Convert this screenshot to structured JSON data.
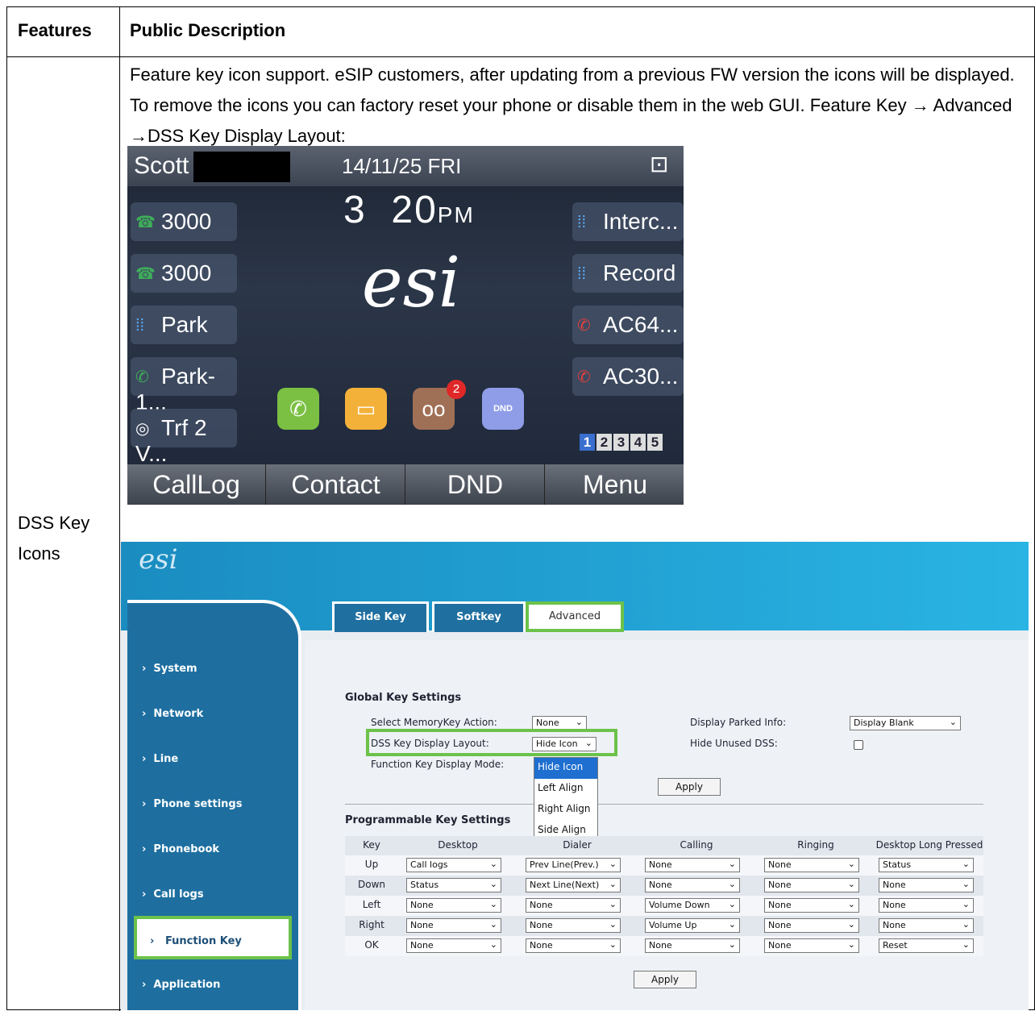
{
  "table": {
    "header_features": "Features",
    "header_description": "Public Description",
    "feature_name": "DSS Key Icons",
    "description": "Feature key icon support. eSIP customers, after updating from a previous FW version the icons will be displayed. To remove the icons you can factory reset your phone or disable them in the web GUI. Feature Key → Advanced →DSS Key Display Layout:"
  },
  "phone": {
    "name": "Scott",
    "date": "14/11/25 FRI",
    "time_hour": "3",
    "time_min": "20",
    "time_suffix": "PM",
    "logo": "esi",
    "left_keys": [
      "3000",
      "3000",
      "Park",
      "Park-1...",
      "Trf 2 V..."
    ],
    "right_keys": [
      "Interc...",
      "Record",
      "AC64...",
      "AC30..."
    ],
    "voicemail_badge": "2",
    "dnd_icon_label": "DND",
    "pages": [
      "1",
      "2",
      "3",
      "4",
      "5"
    ],
    "softkeys": [
      "CallLog",
      "Contact",
      "DND",
      "Menu"
    ]
  },
  "web": {
    "logo": "esi",
    "tabs": [
      "Side Key",
      "Softkey",
      "Advanced"
    ],
    "sidebar": [
      "System",
      "Network",
      "Line",
      "Phone settings",
      "Phonebook",
      "Call logs",
      "Function Key",
      "Application"
    ],
    "global_title": "Global Key Settings",
    "select_memorykey_label": "Select MemoryKey Action:",
    "select_memorykey_value": "None",
    "dss_layout_label": "DSS Key Display Layout:",
    "dss_layout_value": "Hide Icon",
    "function_key_mode_label": "Function Key Display Mode:",
    "display_parked_label": "Display Parked Info:",
    "display_parked_value": "Display Blank",
    "hide_unused_label": "Hide Unused DSS:",
    "dropdown_options": [
      "Hide Icon",
      "Left Align",
      "Right Align",
      "Side Align"
    ],
    "apply": "Apply",
    "prog_title": "Programmable Key Settings",
    "columns": [
      "Key",
      "Desktop",
      "Dialer",
      "Calling",
      "Ringing",
      "Desktop Long Pressed"
    ],
    "rows": [
      {
        "key": "Up",
        "desktop": "Call logs",
        "dialer": "Prev Line(Prev.)",
        "calling": "None",
        "ringing": "None",
        "long": "Status"
      },
      {
        "key": "Down",
        "desktop": "Status",
        "dialer": "Next Line(Next)",
        "calling": "None",
        "ringing": "None",
        "long": "None"
      },
      {
        "key": "Left",
        "desktop": "None",
        "dialer": "None",
        "calling": "Volume Down",
        "ringing": "None",
        "long": "None"
      },
      {
        "key": "Right",
        "desktop": "None",
        "dialer": "None",
        "calling": "Volume Up",
        "ringing": "None",
        "long": "None"
      },
      {
        "key": "OK",
        "desktop": "None",
        "dialer": "None",
        "calling": "None",
        "ringing": "None",
        "long": "Reset"
      }
    ]
  },
  "colors": {
    "highlight_green": "#6cc24a",
    "nav_blue": "#1e6fa0",
    "header_blue": "#29b4e4"
  }
}
